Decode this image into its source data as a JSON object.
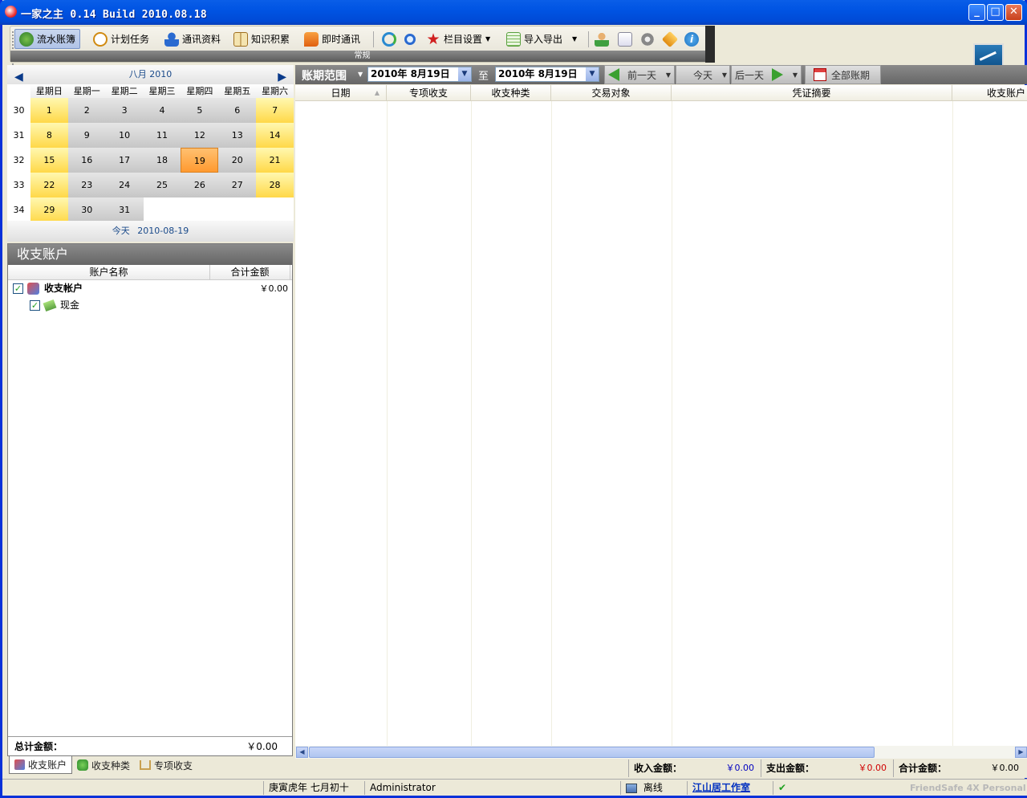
{
  "window": {
    "title": "一家之主 0.14 Build 2010.08.18"
  },
  "toolbar": {
    "items": [
      {
        "label": "流水账簿",
        "color": "#3a9a3a"
      },
      {
        "label": "计划任务",
        "color": "#e0a020"
      },
      {
        "label": "通讯资料",
        "color": "#2a6ad0"
      },
      {
        "label": "知识积累",
        "color": "#c8a050"
      },
      {
        "label": "即时通讯",
        "color": "#e07020"
      },
      {
        "label": "栏目设置",
        "color": "#d02020"
      },
      {
        "label": "导入导出",
        "color": "#5aa040"
      }
    ],
    "group_label": "常规"
  },
  "calendar": {
    "month_label": "八月 2010",
    "weekdays": [
      "星期日",
      "星期一",
      "星期二",
      "星期三",
      "星期四",
      "星期五",
      "星期六"
    ],
    "week_numbers": [
      "30",
      "31",
      "32",
      "33",
      "34"
    ],
    "rows": [
      [
        "1",
        "2",
        "3",
        "4",
        "5",
        "6",
        "7"
      ],
      [
        "8",
        "9",
        "10",
        "11",
        "12",
        "13",
        "14"
      ],
      [
        "15",
        "16",
        "17",
        "18",
        "19",
        "20",
        "21"
      ],
      [
        "22",
        "23",
        "24",
        "25",
        "26",
        "27",
        "28"
      ],
      [
        "29",
        "30",
        "31",
        "",
        "",
        "",
        ""
      ]
    ],
    "selected_day": "19",
    "today_label": "今天",
    "today_date": "2010-08-19"
  },
  "accounts": {
    "title": "收支账户",
    "col_name": "账户名称",
    "col_total": "合计金额",
    "rows": [
      {
        "name": "收支帐户",
        "amount": "￥0.00",
        "bold": true
      },
      {
        "name": "现金",
        "amount": "",
        "bold": false
      }
    ],
    "total_label": "总计金额：",
    "total_value": "￥0.00"
  },
  "bottom_tabs": [
    "收支账户",
    "收支种类",
    "专项收支"
  ],
  "range": {
    "label": "账期范围",
    "start": "2010年 8月19日",
    "to": "至",
    "end": "2010年 8月19日",
    "prev": "前一天",
    "today": "今天",
    "next": "后一天",
    "all": "全部账期"
  },
  "table": {
    "columns": [
      "日期",
      "专项收支",
      "收支种类",
      "交易对象",
      "凭证摘要",
      "收支账户"
    ]
  },
  "summary": {
    "income_label": "收入金额：",
    "income": "￥0.00",
    "expense_label": "支出金额：",
    "expense": "￥0.00",
    "total_label": "合计金额：",
    "total": "￥0.00",
    "expense_color": "#d00000",
    "income_color": "#0000c0"
  },
  "status": {
    "lunar": "庚寅虎年 七月初十",
    "user": "Administrator",
    "conn": "离线",
    "studio": "江山居工作室",
    "product": "FriendSafe 4X Personal"
  }
}
